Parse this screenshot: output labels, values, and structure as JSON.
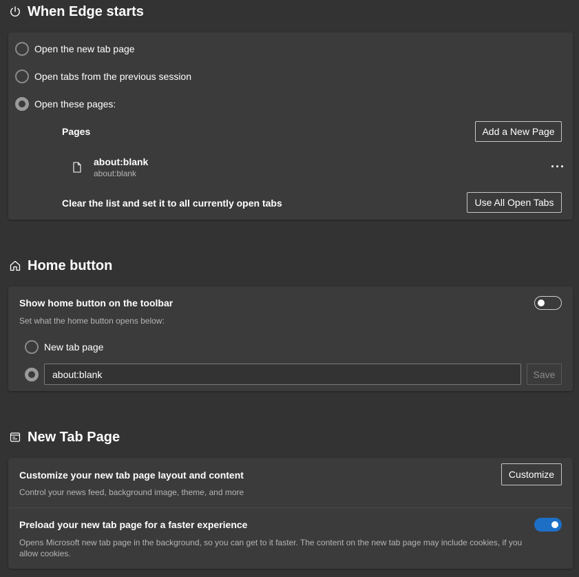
{
  "startup": {
    "title": "When Edge starts",
    "options": [
      {
        "label": "Open the new tab page",
        "checked": false
      },
      {
        "label": "Open tabs from the previous session",
        "checked": false
      },
      {
        "label": "Open these pages:",
        "checked": true
      }
    ],
    "pages_header": "Pages",
    "add_page_button": "Add a New Page",
    "page_entry": {
      "title": "about:blank",
      "url": "about:blank"
    },
    "more_options": "···",
    "clear_label": "Clear the list and set it to all currently open tabs",
    "use_all_tabs_button": "Use All Open Tabs"
  },
  "home": {
    "title": "Home button",
    "show_label": "Show home button on the toolbar",
    "show_toggle_on": false,
    "desc": "Set what the home button opens below:",
    "option_newtab": "New tab page",
    "url_value": "about:blank",
    "save_button": "Save"
  },
  "newtab": {
    "title": "New Tab Page",
    "customize_label": "Customize your new tab page layout and content",
    "customize_desc": "Control your news feed, background image, theme, and more",
    "customize_button": "Customize",
    "preload_label": "Preload your new tab page for a faster experience",
    "preload_desc_line1": "Opens Microsoft new tab page in the background, so you can get to it faster. The content on the new tab page may include cookies, if you",
    "preload_desc_line2": "allow cookies.",
    "preload_toggle_on": true
  },
  "colors": {
    "background": "#333333",
    "card": "#3b3b3b",
    "accent": "#1d6fc6"
  }
}
